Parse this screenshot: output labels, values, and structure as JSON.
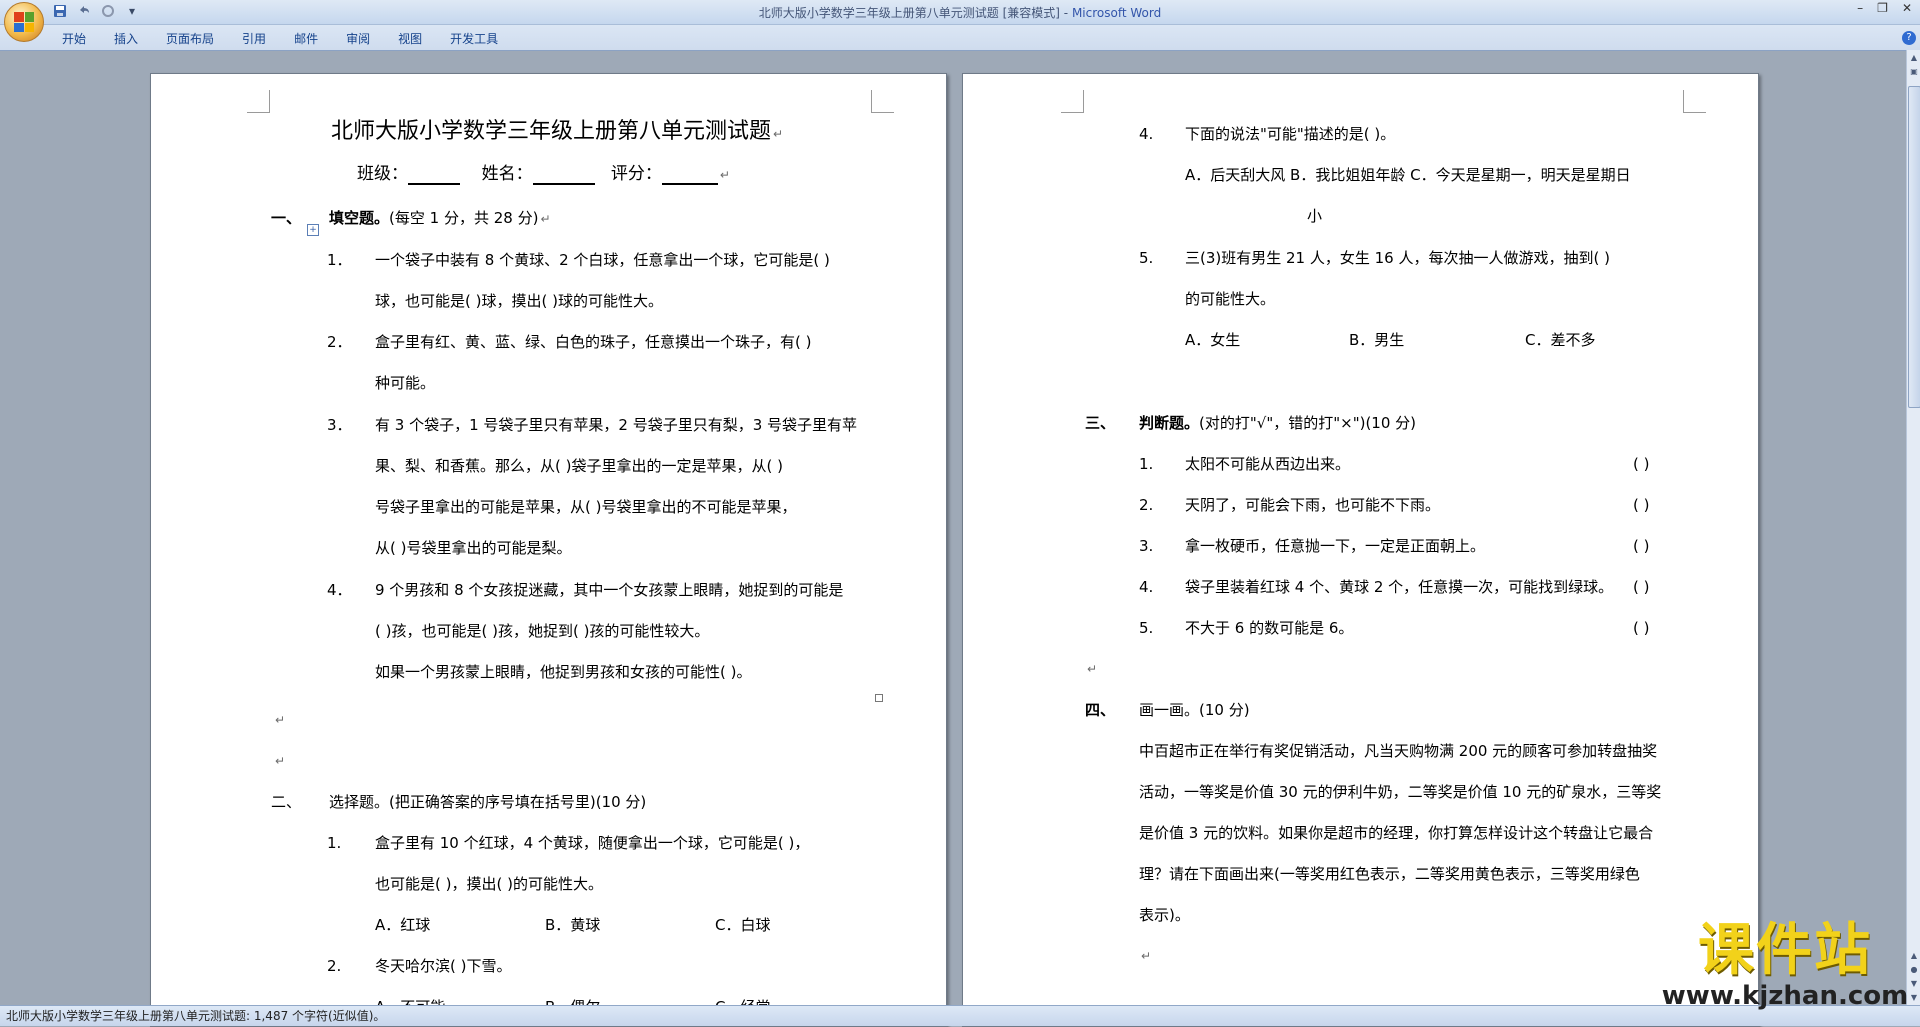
{
  "window": {
    "doc_title": "北师大版小学数学三年级上册第八单元测试题 [兼容模式]",
    "app_name": "Microsoft Word",
    "separator": " - "
  },
  "ribbon": {
    "tabs": [
      "开始",
      "插入",
      "页面布局",
      "引用",
      "邮件",
      "审阅",
      "视图",
      "开发工具"
    ],
    "help": "?"
  },
  "quick_access": {
    "dropdown": "▾"
  },
  "window_controls": {
    "minimize": "–",
    "restore": "❐",
    "close": "✕"
  },
  "page1": {
    "title": "北师大版小学数学三年级上册第八单元测试题",
    "class_label": "班级：",
    "name_label": "姓名：",
    "score_label": "评分：",
    "s1_num": "一、",
    "s1_title_bold": "填空题。",
    "s1_title_rest": "(每空 1 分，共 28 分)",
    "q1_num": "1．",
    "q1_l1": "一个袋子中装有 8 个黄球、2 个白球，任意拿出一个球，它可能是(      )",
    "q1_l2": "球，也可能是(      )球，摸出(      )球的可能性大。",
    "q2_num": "2．",
    "q2_l1": "盒子里有红、黄、蓝、绿、白色的珠子，任意摸出一个珠子，有(      )",
    "q2_l2": "种可能。",
    "q3_num": "3．",
    "q3_l1": "有 3 个袋子，1 号袋子里只有苹果，2 号袋子里只有梨，3 号袋子里有苹",
    "q3_l2": "果、梨、和香蕉。那么，从(      )袋子里拿出的一定是苹果，从(      )",
    "q3_l3": "号袋子里拿出的可能是苹果，从(      )号袋里拿出的不可能是苹果，",
    "q3_l4": "从(      )号袋里拿出的可能是梨。",
    "q4_num": "4．",
    "q4_l1": "9 个男孩和 8 个女孩捉迷藏，其中一个女孩蒙上眼睛，她捉到的可能是",
    "q4_l2": "(      )孩，也可能是(      )孩，她捉到(      )孩的可能性较大。",
    "q4_l3": "如果一个男孩蒙上眼睛，他捉到男孩和女孩的可能性(      )。",
    "s2_num": "二、",
    "s2_title": "选择题。(把正确答案的序号填在括号里)(10 分)",
    "c1_num": "1.",
    "c1_l1": "盒子里有 10 个红球，4 个黄球，随便拿出一个球，它可能是(      )，",
    "c1_l2": "也可能是(      )，摸出(      )的可能性大。",
    "c1_a": "A．红球",
    "c1_b": "B．黄球",
    "c1_c": "C．白球",
    "c2_num": "2.",
    "c2_l1": "冬天哈尔滨(      )下雪。",
    "c2_a": "A．不可能",
    "c2_b": "B．偶尔",
    "c2_c": "C．经常"
  },
  "page2": {
    "c4_num": "4.",
    "c4_l1": "下面的说法\"可能\"描述的是(      )。",
    "c4_opts": "A．后天刮大风   B．我比姐姐年龄   C．今天是星期一，明天是星期日",
    "c4_opts2": "小",
    "c5_num": "5.",
    "c5_l1": "三(3)班有男生 21 人，女生 16 人，每次抽一人做游戏，抽到(      )",
    "c5_l2": "的可能性大。",
    "c5_a": "A．女生",
    "c5_b": "B．男生",
    "c5_c": "C．差不多",
    "s3_num": "三、",
    "s3_title_bold": "判断题。",
    "s3_title_rest": "(对的打\"√\"，错的打\"×\")(10 分)",
    "j1_num": "1.",
    "j1": "太阳不可能从西边出来。",
    "j2_num": "2.",
    "j2": "天阴了，可能会下雨，也可能不下雨。",
    "j3_num": "3.",
    "j3": "拿一枚硬币，任意抛一下，一定是正面朝上。",
    "j4_num": "4.",
    "j4": "袋子里装着红球 4 个、黄球 2 个，任意摸一次，可能找到绿球。",
    "j5_num": "5.",
    "j5": "不大于 6 的数可能是 6。",
    "paren": "(      )",
    "s4_num": "四、",
    "s4_title": "画一画。(10 分)",
    "d_l1": "中百超市正在举行有奖促销活动，凡当天购物满 200 元的顾客可参加转盘抽奖",
    "d_l2": "活动，一等奖是价值 30 元的伊利牛奶，二等奖是价值 10 元的矿泉水，三等奖",
    "d_l3": "是价值 3 元的饮料。如果你是超市的经理，你打算怎样设计这个转盘让它最合",
    "d_l4": "理？请在下面画出来(一等奖用红色表示，二等奖用黄色表示，三等奖用绿色",
    "d_l5": "表示)。"
  },
  "status": {
    "text": "北师大版小学数学三年级上册第八单元测试题: 1,487 个字符(近似值)。"
  },
  "watermark": {
    "line1": "课件站",
    "line2": "www.kjzhan.com"
  },
  "para_mark": "↵",
  "colors": {
    "accent": "#15428b",
    "workspace": "#9ea9b7",
    "watermark_yellow": "#f2d21a"
  }
}
